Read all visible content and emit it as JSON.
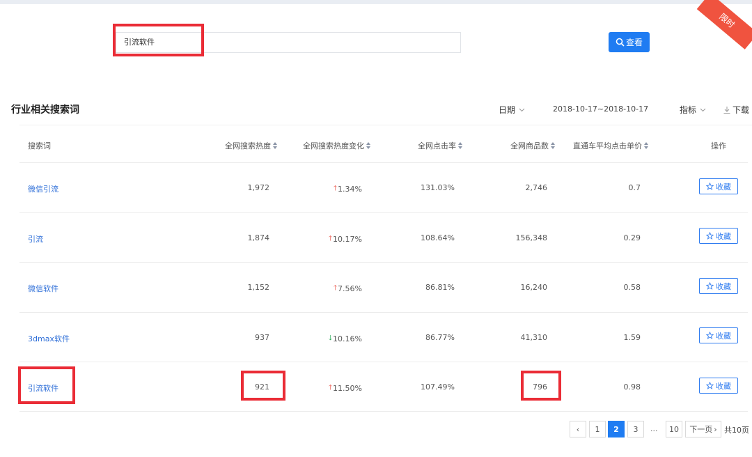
{
  "search": {
    "value": "引流软件",
    "button_label": "查看"
  },
  "corner_badge": "限时",
  "section": {
    "title": "行业相关搜索词",
    "date_label": "日期",
    "date_range": "2018-10-17~2018-10-17",
    "metric_label": "指标",
    "download_label": "下载"
  },
  "table": {
    "headers": {
      "keyword": "搜索词",
      "heat": "全网搜索热度",
      "heat_change": "全网搜索热度变化",
      "ctr": "全网点击率",
      "goods": "全网商品数",
      "cpc": "直通车平均点击单价",
      "action": "操作"
    },
    "rows": [
      {
        "keyword": "微信引流",
        "heat": "1,972",
        "dir": "up",
        "change": "1.34%",
        "ctr": "131.03%",
        "goods": "2,746",
        "cpc": "0.7",
        "fav": "收藏"
      },
      {
        "keyword": "引流",
        "heat": "1,874",
        "dir": "up",
        "change": "10.17%",
        "ctr": "108.64%",
        "goods": "156,348",
        "cpc": "0.29",
        "fav": "收藏"
      },
      {
        "keyword": "微信软件",
        "heat": "1,152",
        "dir": "up",
        "change": "7.56%",
        "ctr": "86.81%",
        "goods": "16,240",
        "cpc": "0.58",
        "fav": "收藏"
      },
      {
        "keyword": "3dmax软件",
        "heat": "937",
        "dir": "down",
        "change": "10.16%",
        "ctr": "86.77%",
        "goods": "41,310",
        "cpc": "1.59",
        "fav": "收藏"
      },
      {
        "keyword": "引流软件",
        "heat": "921",
        "dir": "up",
        "change": "11.50%",
        "ctr": "107.49%",
        "goods": "796",
        "cpc": "0.98",
        "fav": "收藏"
      }
    ]
  },
  "pagination": {
    "prev": "‹",
    "pages": [
      "1",
      "2",
      "3"
    ],
    "current": "2",
    "ellipsis": "...",
    "last": "10",
    "next": "下一页",
    "total": "共10页"
  },
  "colors": {
    "primary": "#1f7cf2",
    "highlight_box": "#ea2c36",
    "up": "#e8483c",
    "down": "#1aa34a",
    "link": "#2f6fd8"
  },
  "icons": {
    "search_button": "search-icon",
    "favorite": "star-icon",
    "download": "download-icon",
    "dropdown": "chevron-down-icon"
  }
}
